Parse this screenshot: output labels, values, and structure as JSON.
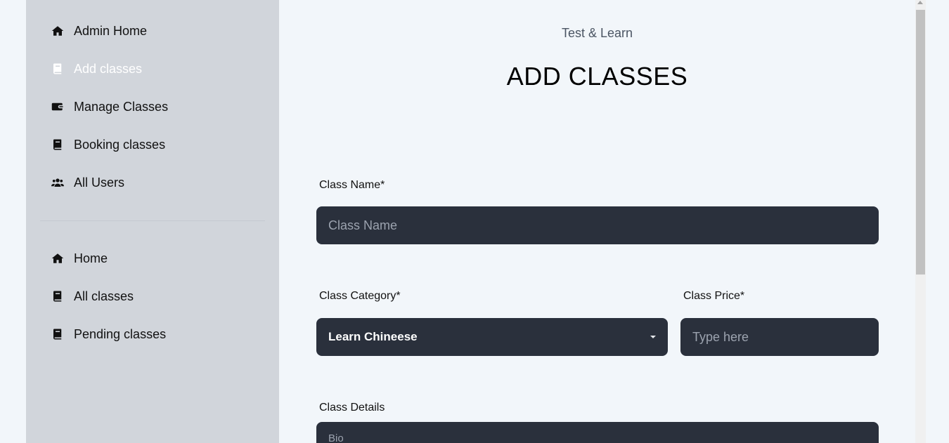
{
  "sidebar": {
    "admin_items": [
      {
        "label": "Admin Home",
        "icon": "home-icon"
      },
      {
        "label": "Add classes",
        "icon": "book-icon",
        "active": true
      },
      {
        "label": "Manage Classes",
        "icon": "wallet-icon"
      },
      {
        "label": "Booking classes",
        "icon": "book-icon"
      },
      {
        "label": "All Users",
        "icon": "users-icon"
      }
    ],
    "general_items": [
      {
        "label": "Home",
        "icon": "home-icon"
      },
      {
        "label": "All classes",
        "icon": "book-icon"
      },
      {
        "label": "Pending classes",
        "icon": "book-icon"
      }
    ]
  },
  "header": {
    "subtitle": "Test & Learn",
    "title": "ADD CLASSES"
  },
  "form": {
    "class_name": {
      "label": "Class Name*",
      "placeholder": "Class Name",
      "value": ""
    },
    "class_category": {
      "label": "Class Category*",
      "selected": "Learn Chineese"
    },
    "class_price": {
      "label": "Class Price*",
      "placeholder": "Type here",
      "value": ""
    },
    "class_details": {
      "label": "Class Details",
      "placeholder": "Bio",
      "value": ""
    }
  },
  "colors": {
    "sidebar_bg": "#d1d5db",
    "page_bg": "#f2f6fa",
    "input_bg": "#2a303c",
    "active_item": "#ffffff"
  }
}
